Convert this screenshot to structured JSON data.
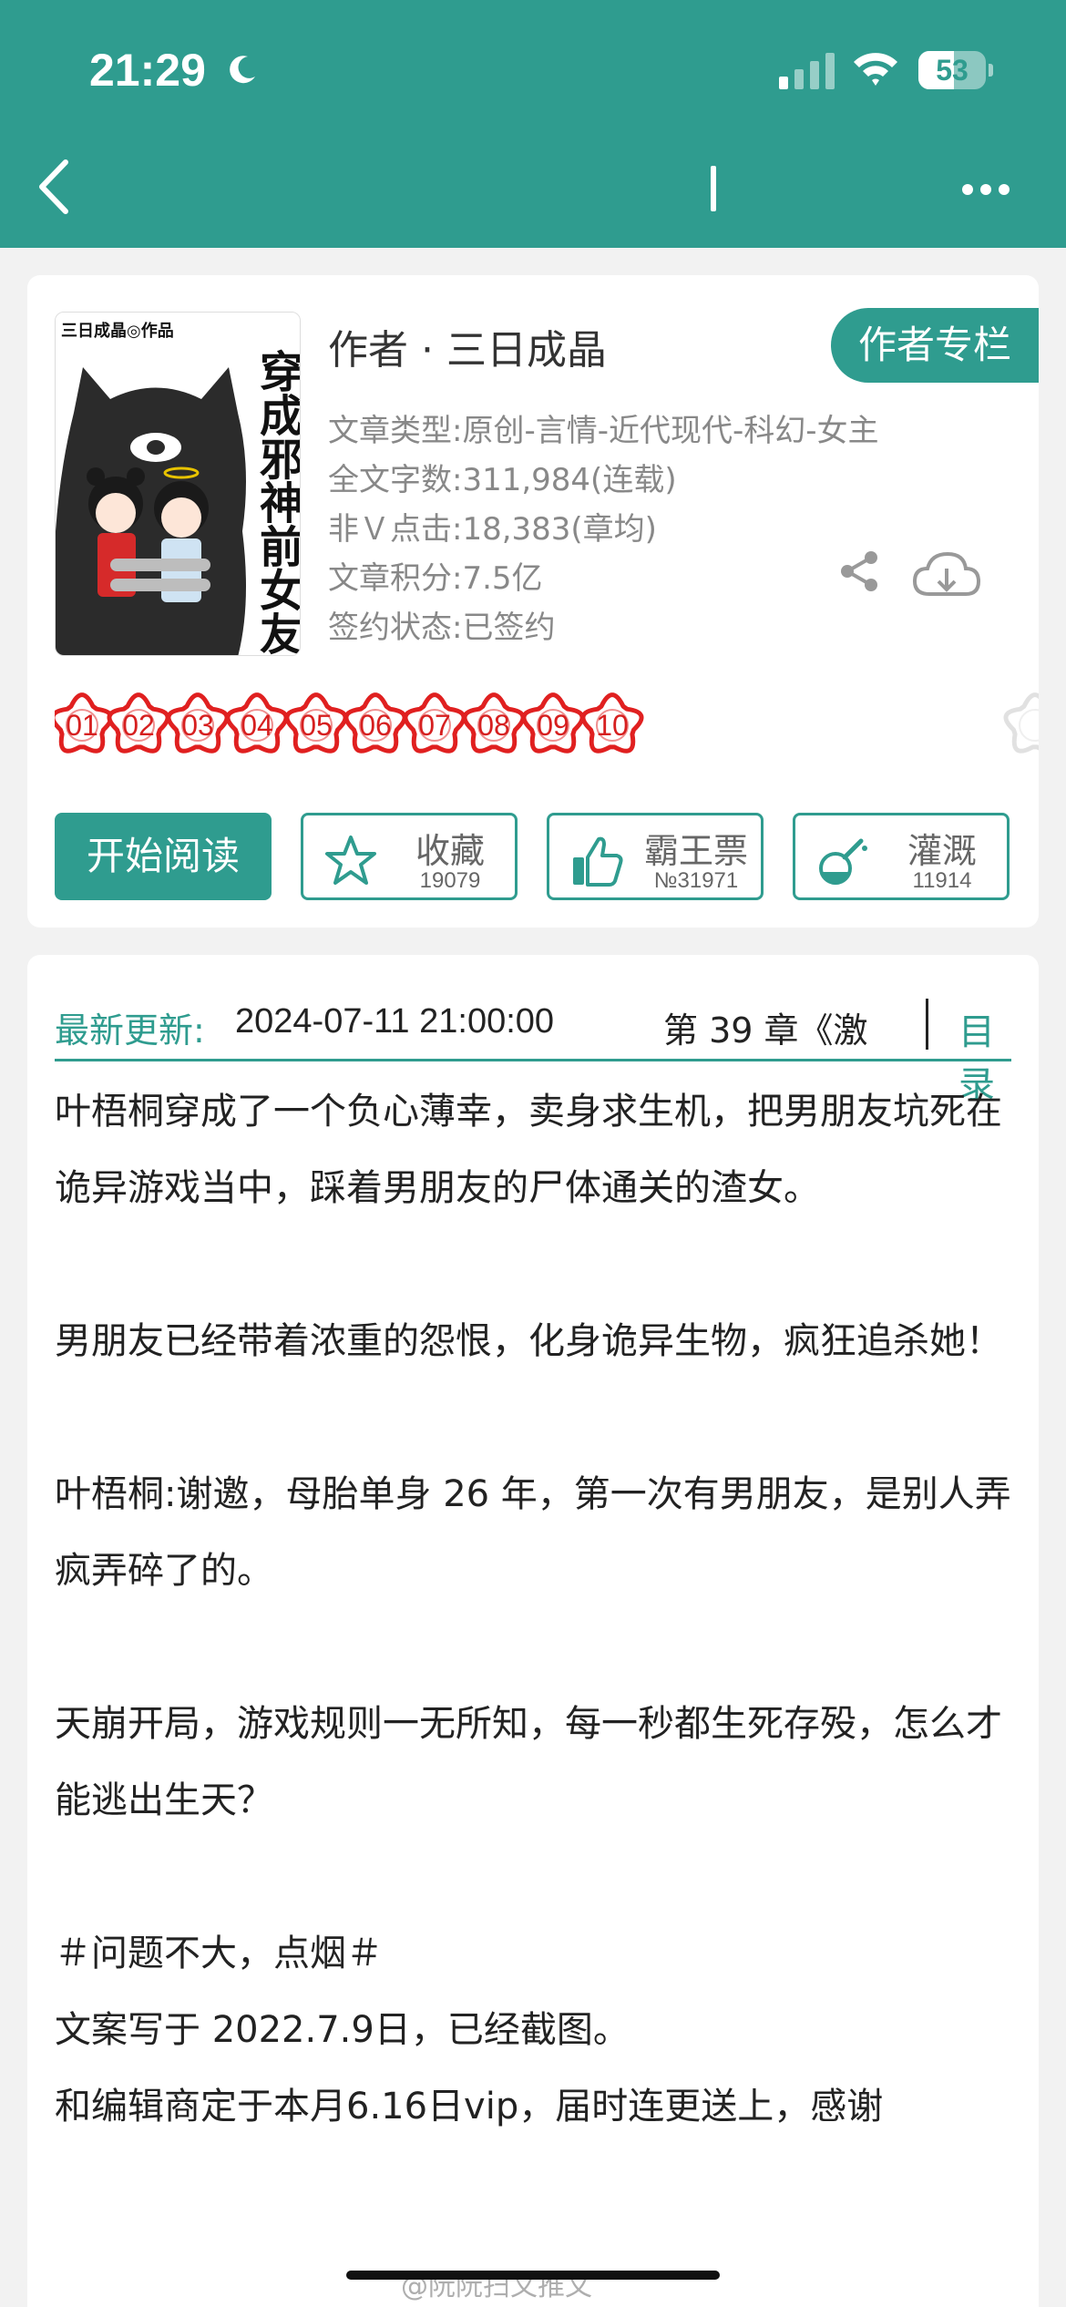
{
  "status_bar": {
    "time": "21:29",
    "battery_level": "53",
    "battery_fraction": 0.53
  },
  "nav": {
    "back_icon": "chevron-left-icon",
    "more_icon": "more-dots-icon"
  },
  "book": {
    "cover_author_tag": "三日成晶◎作品",
    "cover_title": "穿成邪神前女友",
    "author_line": "作者 · 三日成晶",
    "author_column_label": "作者专栏",
    "meta": [
      "文章类型:原创-言情-近代现代-科幻-女主",
      "全文字数:311,984(连载)",
      "非Ｖ点击:18,383(章均)",
      "文章积分:7.5亿",
      "签约状态:已签约"
    ],
    "flowers": [
      "01",
      "02",
      "03",
      "04",
      "05",
      "06",
      "07",
      "08",
      "09",
      "10"
    ],
    "actions": {
      "read_label": "开始阅读",
      "favorite": {
        "label": "收藏",
        "count": "19079",
        "icon": "star-icon"
      },
      "overlord": {
        "label": "霸王票",
        "count": "№31971",
        "icon": "thumbs-up-icon"
      },
      "irrigate": {
        "label": "灌溉",
        "count": "11914",
        "icon": "watering-flask-icon"
      }
    }
  },
  "update": {
    "label": "最新更新:",
    "date": "2024-07-11 21:00:00",
    "chapter": "第 39 章《激",
    "toc_label": "目录"
  },
  "synopsis": [
    "叶梧桐穿成了一个负心薄幸，卖身求生机，把男朋友坑死在诡异游戏当中，踩着男朋友的尸体通关的渣女。",
    "",
    "男朋友已经带着浓重的怨恨，化身诡异生物，疯狂追杀她！",
    "",
    "叶梧桐:谢邀，母胎单身 26 年，第一次有男朋友，是别人弄疯弄碎了的。",
    "",
    "天崩开局，游戏规则一无所知，每一秒都生死存殁，怎么才能逃出生天？",
    "",
    "＃问题不大，点烟＃",
    "文案写于 2022.7.9日，已经截图。",
    "和编辑商定于本月6.16日vip，届时连更送上，感谢"
  ],
  "watermark": "@阮阮扫文推文"
}
